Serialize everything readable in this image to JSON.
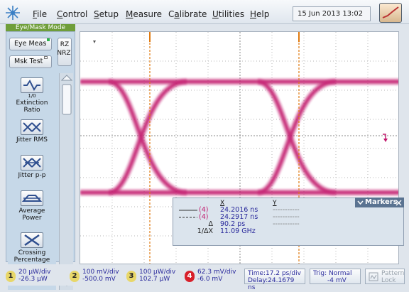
{
  "menu": {
    "items": [
      "File",
      "Control",
      "Setup",
      "Measure",
      "Calibrate",
      "Utilities",
      "Help"
    ],
    "underline": [
      "F",
      "C",
      "S",
      "M",
      "a",
      "U",
      "H"
    ],
    "rest": [
      "ile",
      "ontrol",
      "etup",
      "easure",
      "",
      "tilities",
      "elp"
    ],
    "calib_pre": "C",
    "calib_post": "librate",
    "datetime": "15 Jun 2013  13:02"
  },
  "mode": {
    "title": "Eye/Mask Mode",
    "eye_meas": "Eye Meas",
    "msk_test": "Msk Test",
    "rz": "RZ",
    "nrz": "NRZ"
  },
  "tools": [
    {
      "label": "Extinction Ratio",
      "sub": "1/0"
    },
    {
      "label": "Jitter RMS"
    },
    {
      "label": "Jitter p-p"
    },
    {
      "label": "Average Power"
    },
    {
      "label": "Crossing Percentage"
    }
  ],
  "markers": {
    "title": "Markers",
    "col_x": "X",
    "col_y": "Y",
    "row1_label": "(4)",
    "row1_x": "24.2016 ns",
    "row1_y": "-----------",
    "row2_label": "(4)",
    "row2_x": "24.2917 ns",
    "row2_y": "-----------",
    "delta_label": "Δ",
    "delta_x": "90.2 ps",
    "delta_y": "-----------",
    "inv_label": "1/ΔX",
    "inv_x": "11.09 GHz"
  },
  "status": {
    "ch1": {
      "num": "1",
      "scale": "20 µW/div",
      "offset": "-26.3 µW"
    },
    "ch2": {
      "num": "2",
      "scale": "100 mV/div",
      "offset": "-500.0 mV"
    },
    "ch3": {
      "num": "3",
      "scale": "100 µW/div",
      "offset": "102.7 µW"
    },
    "ch4": {
      "num": "4",
      "scale": "62.3 mV/div",
      "offset": "-6.0 mV"
    },
    "time": "Time:17.2 ps/div",
    "delay": "Delay:24.1679 ns",
    "trig": "Trig: Normal",
    "trig_level": "-4 mV",
    "pattern": "Pattern",
    "lock": "Lock"
  },
  "colors": {
    "eye": "#c2186c",
    "marker_line": "#e07a10",
    "ch1": "#e6d45c",
    "ch2": "#e6d45c",
    "ch3": "#e6d45c",
    "ch4": "#d8202a"
  }
}
